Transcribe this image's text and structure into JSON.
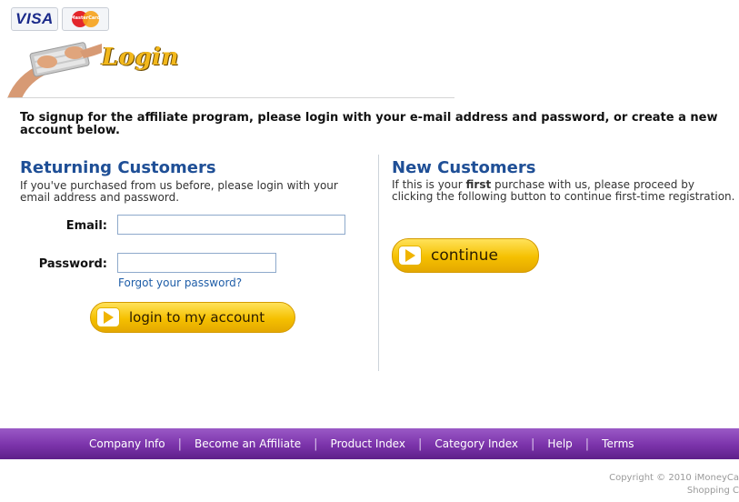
{
  "cards": {
    "visa": "VISA",
    "mastercard": "MasterCard"
  },
  "header": {
    "title": "Login"
  },
  "intro": "To signup for the affiliate program, please login with your e-mail address and password, or create a new account below.",
  "returning": {
    "title": "Returning Customers",
    "description": "If you've purchased from us before, please login with your email address and password.",
    "email_label": "Email:",
    "email_value": "",
    "password_label": "Password:",
    "password_value": "",
    "forgot_link": "Forgot your password?",
    "login_button": "login to my account"
  },
  "new_customers": {
    "title": "New Customers",
    "desc_before": "If this is your ",
    "desc_bold": "first",
    "desc_after": " purchase with us, please proceed by clicking the following button to continue first-time registration.",
    "continue_button": "continue"
  },
  "footer": {
    "nav": [
      "Company Info",
      "Become an Affiliate",
      "Product Index",
      "Category Index",
      "Help",
      "Terms"
    ],
    "copyright_line1": "Copyright © 2010 iMoneyCa",
    "copyright_line2": "Shopping C"
  },
  "colors": {
    "title_blue": "#1f4f96",
    "button_yellow": "#f5c000",
    "footer_purple": "#7e36ad",
    "link_blue": "#1f5ea8"
  }
}
